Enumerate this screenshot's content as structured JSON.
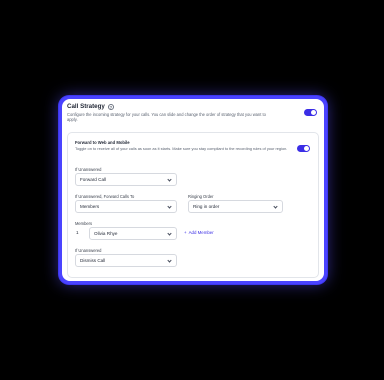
{
  "call_strategy": {
    "title": "Call Strategy",
    "info_icon": "?",
    "description": "Configure the incoming strategy for your calls. You can slide and change the order of strategy that you want to apply.",
    "enabled": true
  },
  "forward": {
    "title": "Forward to Web and Mobile",
    "description": "Toggle on to receive all of your calls as soon as it starts. Make sure you stay compliant to the recording rules of your region.",
    "enabled": true
  },
  "if_unanswered_1": {
    "label": "If Unanswered",
    "value": "Forward Call"
  },
  "forward_calls_to": {
    "label": "If Unanswered, Forward Calls To",
    "value": "Members"
  },
  "ringing_order": {
    "label": "Ringing Order",
    "value": "Ring in order"
  },
  "members": {
    "label": "Members",
    "items": [
      {
        "index": "1",
        "name": "Olivia Rhye"
      }
    ],
    "add_label": "Add Member"
  },
  "if_unanswered_2": {
    "label": "If Unanswered",
    "value": "Dismiss Call"
  },
  "colors": {
    "accent": "#3b2ee6",
    "glow": "#4a43ff"
  }
}
